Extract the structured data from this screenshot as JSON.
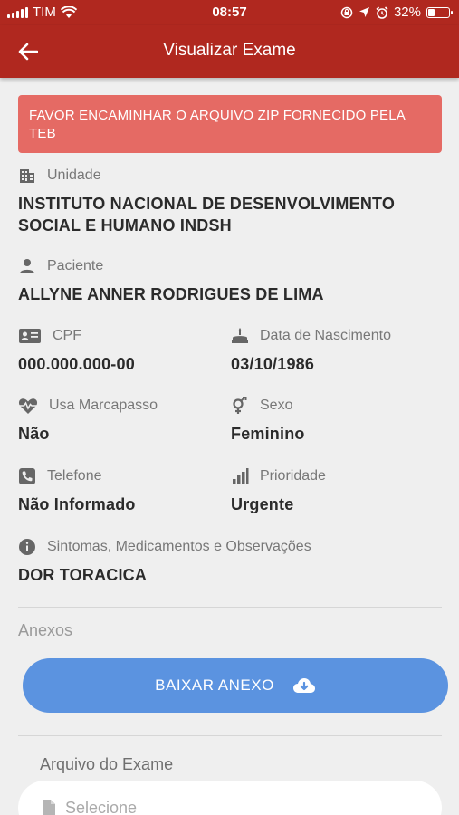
{
  "status_bar": {
    "carrier": "TIM",
    "time": "08:57",
    "battery": "32%",
    "battery_level": 0.32
  },
  "header": {
    "title": "Visualizar Exame",
    "back_icon": "arrow-left-icon"
  },
  "alert": {
    "text": "FAVOR ENCAMINHAR O ARQUIVO ZIP FORNECIDO PELA TEB",
    "color": "#e56a64"
  },
  "fields": {
    "unidade": {
      "label": "Unidade",
      "value": "INSTITUTO NACIONAL DE DESENVOLVIMENTO SOCIAL E HUMANO INDSH",
      "icon": "building-icon"
    },
    "paciente": {
      "label": "Paciente",
      "value": "ALLYNE ANNER RODRIGUES DE LIMA",
      "icon": "person-icon"
    },
    "cpf": {
      "label": "CPF",
      "value": "000.000.000-00",
      "icon": "id-card-icon"
    },
    "nascimento": {
      "label": "Data de Nascimento",
      "value": "03/10/1986",
      "icon": "cake-icon"
    },
    "marcapasso": {
      "label": "Usa Marcapasso",
      "value": "Não",
      "icon": "heartbeat-icon"
    },
    "sexo": {
      "label": "Sexo",
      "value": "Feminino",
      "icon": "gender-icon"
    },
    "telefone": {
      "label": "Telefone",
      "value": "Não Informado",
      "icon": "phone-icon"
    },
    "prioridade": {
      "label": "Prioridade",
      "value": "Urgente",
      "icon": "signal-bars-icon"
    },
    "sintomas": {
      "label": "Sintomas, Medicamentos e Observações",
      "value": "DOR TORACICA",
      "icon": "info-icon"
    }
  },
  "anexos": {
    "title": "Anexos",
    "download_label": "BAIXAR ANEXO",
    "download_icon": "cloud-download-icon"
  },
  "exam_file": {
    "label": "Arquivo do Exame",
    "placeholder": "Selecione",
    "icon": "file-icon"
  },
  "colors": {
    "header": "#b0281f",
    "button": "#5b93e0",
    "background": "#efefef"
  }
}
